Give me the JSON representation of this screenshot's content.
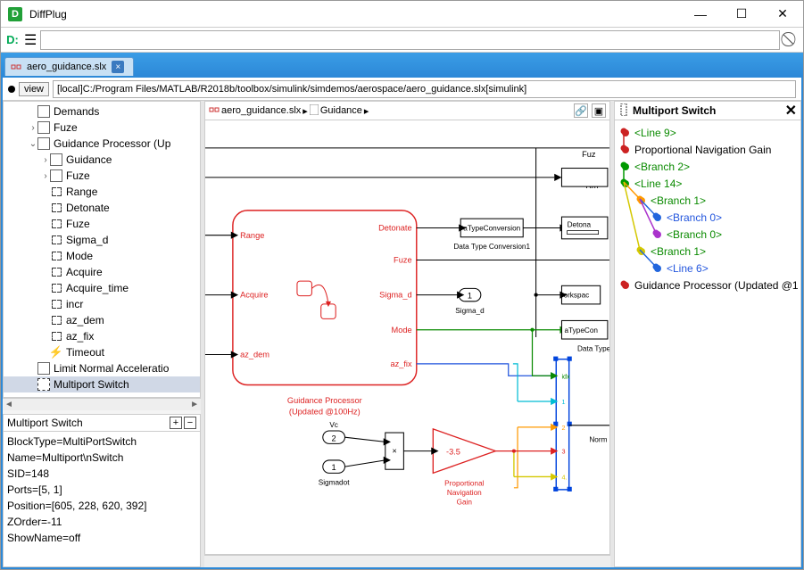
{
  "titlebar": {
    "app_name": "DiffPlug"
  },
  "toolbar": {
    "logo_text": "D:"
  },
  "tab": {
    "label": "aero_guidance.slx"
  },
  "viewbar": {
    "view_btn": "view",
    "path": "[local]C:/Program Files/MATLAB/R2018b/toolbox/simulink/simdemos/aerospace/aero_guidance.slx[simulink]"
  },
  "tree": {
    "items": [
      {
        "indent": 2,
        "twisty": "",
        "icon": "box",
        "label": "Demands"
      },
      {
        "indent": 2,
        "twisty": ">",
        "icon": "box",
        "label": "Fuze"
      },
      {
        "indent": 2,
        "twisty": "v",
        "icon": "subsys",
        "label": "Guidance Processor (Up"
      },
      {
        "indent": 3,
        "twisty": ">",
        "icon": "sheet",
        "label": "Guidance"
      },
      {
        "indent": 3,
        "twisty": ">",
        "icon": "box",
        "label": "Fuze"
      },
      {
        "indent": 3,
        "twisty": "",
        "icon": "port",
        "label": "Range"
      },
      {
        "indent": 3,
        "twisty": "",
        "icon": "port",
        "label": "Detonate"
      },
      {
        "indent": 3,
        "twisty": "",
        "icon": "port",
        "label": "Fuze"
      },
      {
        "indent": 3,
        "twisty": "",
        "icon": "port",
        "label": "Sigma_d"
      },
      {
        "indent": 3,
        "twisty": "",
        "icon": "port",
        "label": "Mode"
      },
      {
        "indent": 3,
        "twisty": "",
        "icon": "port",
        "label": "Acquire"
      },
      {
        "indent": 3,
        "twisty": "",
        "icon": "port",
        "label": "Acquire_time"
      },
      {
        "indent": 3,
        "twisty": "",
        "icon": "port",
        "label": "incr"
      },
      {
        "indent": 3,
        "twisty": "",
        "icon": "port",
        "label": "az_dem"
      },
      {
        "indent": 3,
        "twisty": "",
        "icon": "port",
        "label": "az_fix"
      },
      {
        "indent": 3,
        "twisty": "",
        "icon": "bolt",
        "label": "Timeout"
      },
      {
        "indent": 2,
        "twisty": "",
        "icon": "box",
        "label": "Limit Normal Acceleratio"
      },
      {
        "indent": 2,
        "twisty": "",
        "icon": "mps",
        "label": "Multiport Switch",
        "selected": true
      }
    ]
  },
  "props": {
    "title": "Multiport Switch",
    "lines": [
      "BlockType=MultiPortSwitch",
      "Name=Multiport\\nSwitch",
      "SID=148",
      "Ports=[5, 1]",
      "Position=[605, 228, 620, 392]",
      "ZOrder=-11",
      "ShowName=off"
    ]
  },
  "crumbs": {
    "root": "aero_guidance.slx",
    "seg": "Guidance"
  },
  "right_panel": {
    "title": "Multiport Switch",
    "rows": [
      {
        "indent": 0,
        "color": "#cc2222",
        "label": "<Line 9>",
        "style": "green-text"
      },
      {
        "indent": 0,
        "color": "#cc2222",
        "label": "Proportional Navigation Gain",
        "style": "plain"
      },
      {
        "indent": 0,
        "color": "#009900",
        "label": "<Branch 2>",
        "style": "green-text"
      },
      {
        "indent": 0,
        "color": "#009900",
        "label": "<Line 14>",
        "style": "green-text"
      },
      {
        "indent": 1,
        "color": "#ff9900",
        "label": "<Branch 1>",
        "style": "green-text"
      },
      {
        "indent": 2,
        "color": "#2266dd",
        "label": "<Branch 0>",
        "style": "blue-text"
      },
      {
        "indent": 2,
        "color": "#aa33cc",
        "label": "<Branch 0>",
        "style": "green-text"
      },
      {
        "indent": 1,
        "color": "#d4c800",
        "label": "<Branch 1>",
        "style": "green-text"
      },
      {
        "indent": 2,
        "color": "#2266dd",
        "label": "<Line 6>",
        "style": "blue-text"
      },
      {
        "indent": 0,
        "color": "#cc2222",
        "label": "Guidance Processor (Updated @1",
        "style": "plain"
      }
    ]
  },
  "diagram": {
    "guidance_block": {
      "title_l1": "Guidance Processor",
      "title_l2": "(Updated @100Hz)"
    },
    "ports_left": [
      "Range",
      "Acquire",
      "az_dem"
    ],
    "ports_right": [
      "Detonate",
      "Fuze",
      "Sigma_d",
      "Mode",
      "az_fix"
    ],
    "gain": {
      "value": "-3.5",
      "label_l1": "Proportional",
      "label_l2": "Navigation",
      "label_l3": "Gain"
    },
    "vc_label": "Vc",
    "vc_num": "2",
    "sigmadot_label": "Sigmadot",
    "sigmadot_num": "1",
    "product_op": "×",
    "sigma_d_out": {
      "num": "1",
      "label": "Sigma_d"
    },
    "dtc1": {
      "text": "aTypeConversion",
      "label": "Data Type Conversion1"
    },
    "dtc2": {
      "text": "aTypeCon",
      "label": "Data Type Co"
    },
    "workspace": {
      "text": "orkspac"
    },
    "rm_label": "Rm",
    "fuz_label": "Fuz",
    "detona_label": "Detona",
    "norm_label": "Norm",
    "switch_ports": [
      "idx",
      "1",
      "2",
      "3",
      "4."
    ]
  },
  "chart_data": {
    "type": "diagram",
    "description": "Simulink block diagram — Guidance subsystem",
    "blocks": [
      {
        "name": "Guidance Processor (Updated @100Hz)",
        "type": "Subsystem",
        "inports": [
          "Range",
          "Acquire",
          "az_dem"
        ],
        "outports": [
          "Detonate",
          "Fuze",
          "Sigma_d",
          "Mode",
          "az_fix"
        ]
      },
      {
        "name": "Vc",
        "type": "Inport",
        "port": 2
      },
      {
        "name": "Sigmadot",
        "type": "Inport",
        "port": 1
      },
      {
        "name": "Product",
        "type": "Product"
      },
      {
        "name": "Proportional Navigation Gain",
        "type": "Gain",
        "value": -3.5
      },
      {
        "name": "Sigma_d",
        "type": "Outport",
        "port": 1
      },
      {
        "name": "Data Type Conversion1",
        "type": "DataTypeConversion"
      },
      {
        "name": "Data Type Conversion",
        "type": "DataTypeConversion"
      },
      {
        "name": "Workspace",
        "type": "ToWorkspace"
      },
      {
        "name": "Multiport Switch",
        "type": "MultiPortSwitch",
        "ports_in": [
          "idx",
          "1",
          "2",
          "3",
          "4"
        ],
        "ports_out": 1
      },
      {
        "name": "Rm",
        "type": "SignalLabel"
      },
      {
        "name": "Fuz",
        "type": "SignalLabel"
      },
      {
        "name": "Detona",
        "type": "SignalLabel"
      },
      {
        "name": "Norm",
        "type": "SignalLabel"
      }
    ],
    "selected_block": "Multiport Switch",
    "selected_block_props": {
      "BlockType": "MultiPortSwitch",
      "Name": "Multiport\\nSwitch",
      "SID": 148,
      "Ports": [
        5,
        1
      ],
      "Position": [
        605,
        228,
        620,
        392
      ],
      "ZOrder": -11,
      "ShowName": "off"
    }
  }
}
